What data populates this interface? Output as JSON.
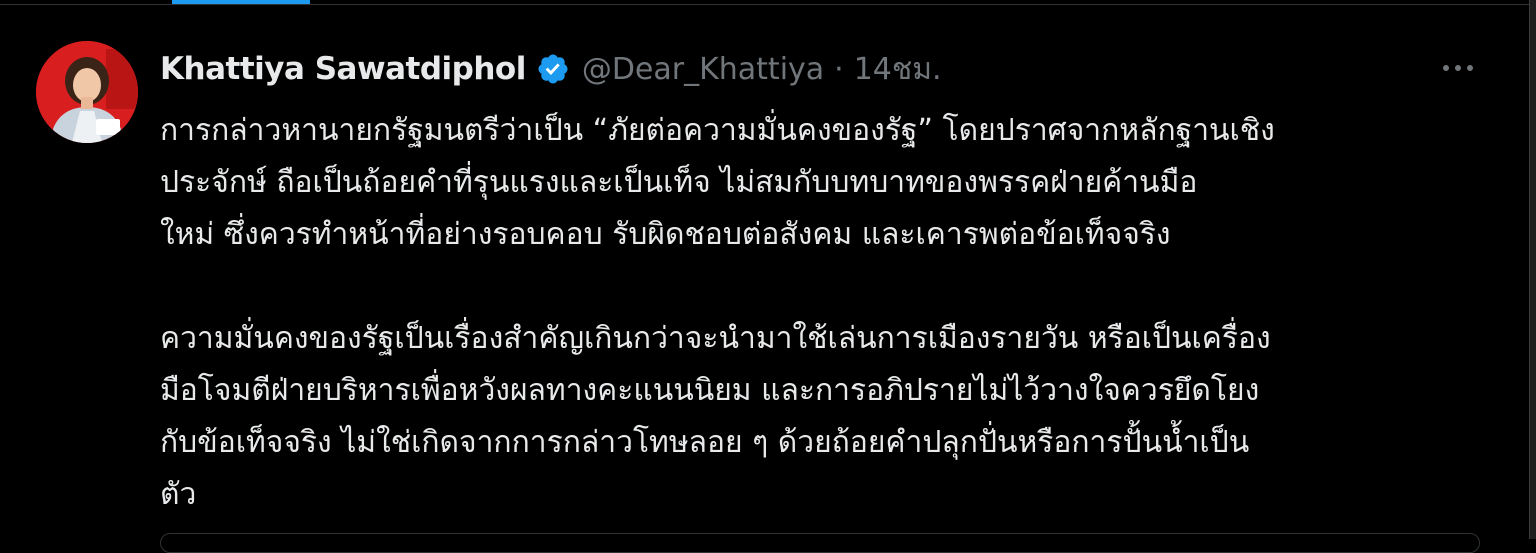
{
  "tweet": {
    "author": {
      "display_name": "Khattiya Sawatdiphol",
      "verified": true,
      "handle": "@Dear_Khattiya",
      "separator": "·",
      "time": "14ชม."
    },
    "paragraphs": [
      "การกล่าวหานายกรัฐมนตรีว่าเป็น “ภัยต่อความมั่นคงของรัฐ” โดยปราศจากหลักฐานเชิง\nประจักษ์ ถือเป็นถ้อยคำที่รุนแรงและเป็นเท็จ ไม่สมกับบทบาทของพรรคฝ่ายค้านมือ\nใหม่ ซึ่งควรทำหน้าที่อย่างรอบคอบ รับผิดชอบต่อสังคม และเคารพต่อข้อเท็จจริง",
      "ความมั่นคงของรัฐเป็นเรื่องสำคัญเกินกว่าจะนำมาใช้เล่นการเมืองรายวัน หรือเป็นเครื่อง\nมือโจมตีฝ่ายบริหารเพื่อหวังผลทางคะแนนนิยม และการอภิปรายไม่ไว้วางใจควรยึดโยง\nกับข้อเท็จจริง ไม่ใช่เกิดจากการกล่าวโทษลอย ๆ ด้วยถ้อยคำปลุกปั่นหรือการปั้นน้ำเป็น\nตัว"
    ]
  },
  "icons": {
    "avatar": "profile-photo",
    "verified": "verified-badge-icon",
    "more": "more-options-icon"
  },
  "colors": {
    "background": "#000000",
    "text_primary": "#e7e9ea",
    "text_secondary": "#71767b",
    "accent": "#1d9bf0"
  }
}
